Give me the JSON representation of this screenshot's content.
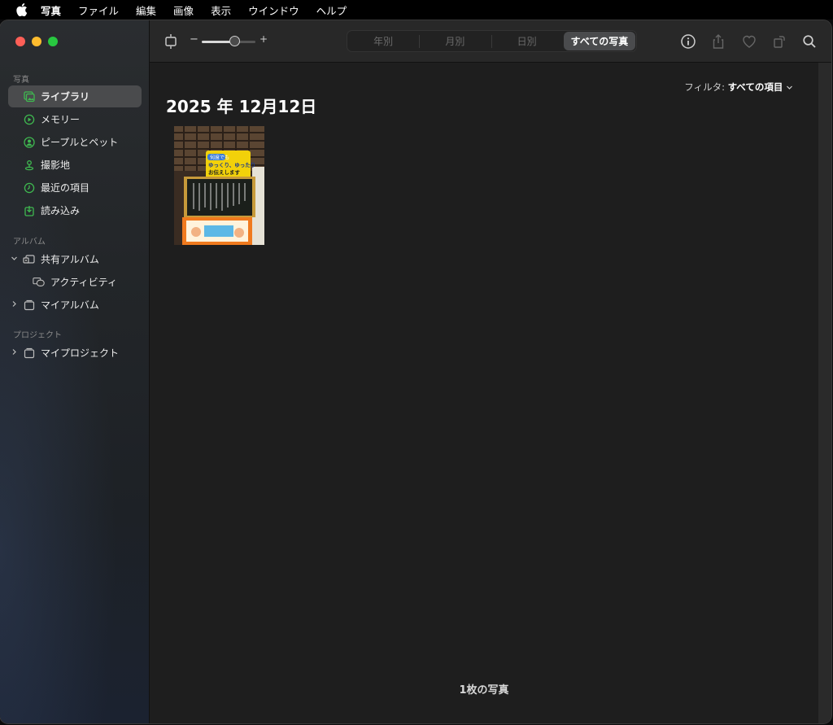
{
  "menubar": {
    "app": "写真",
    "items": [
      "ファイル",
      "編集",
      "画像",
      "表示",
      "ウインドウ",
      "ヘルプ"
    ]
  },
  "sidebar": {
    "sections": {
      "photos": "写真",
      "albums": "アルバム",
      "projects": "プロジェクト"
    },
    "items": [
      {
        "label": "ライブラリ",
        "icon": "library-icon",
        "selected": true
      },
      {
        "label": "メモリー",
        "icon": "memories-icon"
      },
      {
        "label": "ピープルとペット",
        "icon": "people-icon"
      },
      {
        "label": "撮影地",
        "icon": "places-icon"
      },
      {
        "label": "最近の項目",
        "icon": "recents-icon"
      },
      {
        "label": "読み込み",
        "icon": "imports-icon"
      }
    ],
    "albums": [
      {
        "label": "共有アルバム",
        "icon": "shared-albums-icon",
        "expanded": true
      },
      {
        "label": "アクティビティ",
        "icon": "activity-icon"
      },
      {
        "label": "マイアルバム",
        "icon": "album-folder-icon",
        "expanded": false
      }
    ],
    "projects": [
      {
        "label": "マイプロジェクト",
        "icon": "project-folder-icon",
        "expanded": false
      }
    ]
  },
  "toolbar": {
    "zoom_minus": "−",
    "zoom_plus": "+",
    "zoom_level": 0.6,
    "segments": [
      "年別",
      "月別",
      "日別",
      "すべての写真"
    ],
    "active_segment": "すべての写真"
  },
  "main": {
    "filter_label": "フィルタ:",
    "filter_value": "すべての項目",
    "date_heading": "2025 年 12月12日",
    "photo_count": "1枚の写真",
    "photo": {
      "sign_top": "何度でも",
      "sign_mid": "ゆっくり、ゆったり",
      "sign_bottom": "お伝えします"
    }
  },
  "colors": {
    "accent_green": "#3fb950",
    "close": "#fe5f57",
    "minimize": "#febc2e",
    "maximize": "#28c840"
  }
}
